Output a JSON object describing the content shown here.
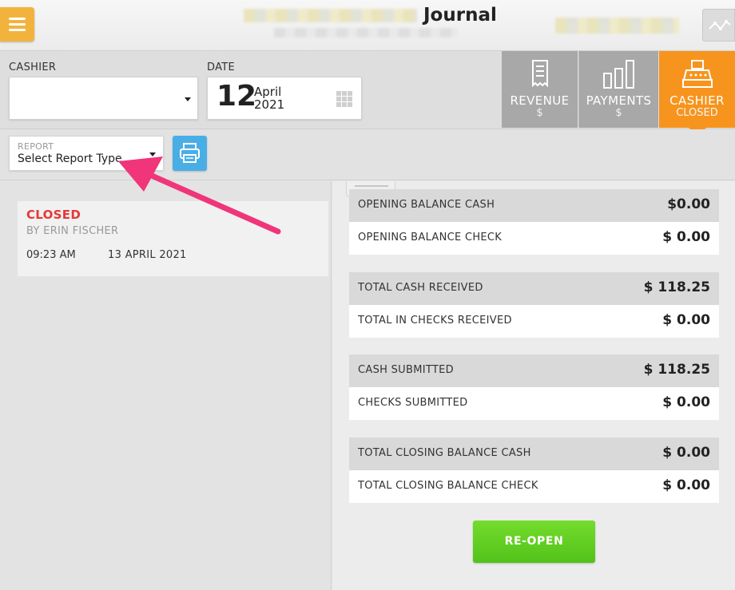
{
  "header": {
    "title": "Journal",
    "menu_icon": "hamburger-icon",
    "activity_icon": "activity-graph-icon"
  },
  "filters": {
    "cashier_label": "CASHIER",
    "cashier_value": "",
    "date_label": "DATE",
    "date_day": "12",
    "date_month": "April",
    "date_year": "2021"
  },
  "tabs": [
    {
      "label": "REVENUE",
      "sub": "$",
      "icon": "receipt-icon",
      "active": false
    },
    {
      "label": "PAYMENTS",
      "sub": "$",
      "icon": "bar-chart-icon",
      "active": false
    },
    {
      "label": "CASHIER",
      "sub": "CLOSED",
      "icon": "cash-register-icon",
      "active": true
    }
  ],
  "report": {
    "label": "REPORT",
    "value": "Select Report Type",
    "print_icon": "printer-icon"
  },
  "session": {
    "status": "CLOSED",
    "by": "BY ERIN FISCHER",
    "time": "09:23 AM",
    "date": "13 APRIL 2021"
  },
  "balances": [
    {
      "label": "OPENING BALANCE CASH",
      "value": "$0.00"
    },
    {
      "label": "OPENING BALANCE CHECK",
      "value": "$ 0.00"
    },
    {
      "label": "TOTAL CASH RECEIVED",
      "value": "$ 118.25"
    },
    {
      "label": "TOTAL IN CHECKS RECEIVED",
      "value": "$ 0.00"
    },
    {
      "label": "CASH SUBMITTED",
      "value": "$ 118.25"
    },
    {
      "label": "CHECKS SUBMITTED",
      "value": "$ 0.00"
    },
    {
      "label": "TOTAL CLOSING BALANCE CASH",
      "value": "$ 0.00"
    },
    {
      "label": "TOTAL CLOSING BALANCE CHECK",
      "value": "$ 0.00"
    }
  ],
  "actions": {
    "reopen_label": "RE-OPEN"
  },
  "colors": {
    "accent_orange": "#f7941d",
    "menu_yellow": "#f2b33d",
    "print_blue": "#49aee6",
    "reopen_green": "#5ccc1f",
    "status_red": "#e53935",
    "annotation_pink": "#f0357a"
  }
}
